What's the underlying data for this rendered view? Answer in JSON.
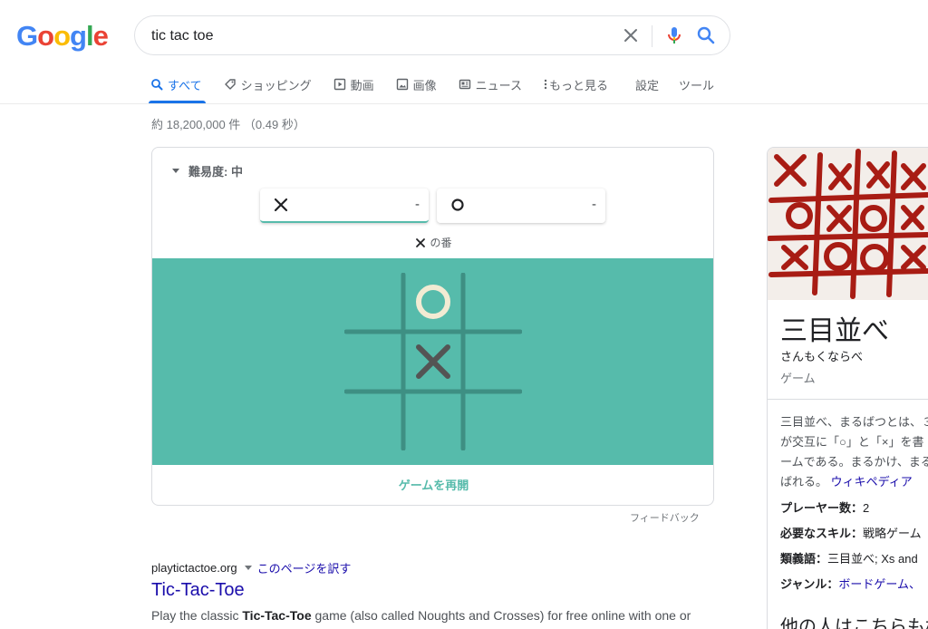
{
  "logo": {
    "letters": [
      "G",
      "o",
      "o",
      "g",
      "l",
      "e"
    ],
    "colors": [
      "#4285f4",
      "#ea4335",
      "#fbbc05",
      "#4285f4",
      "#34a853",
      "#ea4335"
    ]
  },
  "search": {
    "query": "tic tac toe"
  },
  "tabs": [
    {
      "label": "すべて",
      "icon": "search-icon",
      "active": true
    },
    {
      "label": "ショッピング",
      "icon": "tag-icon"
    },
    {
      "label": "動画",
      "icon": "video-icon"
    },
    {
      "label": "画像",
      "icon": "image-icon"
    },
    {
      "label": "ニュース",
      "icon": "news-icon"
    },
    {
      "label": "もっと見る",
      "icon": "more-vert-icon"
    }
  ],
  "tools": {
    "settings": "設定",
    "tools": "ツール"
  },
  "stats": "約 18,200,000 件 （0.49 秒）",
  "game": {
    "difficulty": "難易度: 中",
    "player1": {
      "mark": "X",
      "score": "-"
    },
    "player2": {
      "mark": "O",
      "score": "-"
    },
    "turn": "の番",
    "board": [
      "",
      "O",
      "",
      "",
      "X",
      "",
      "",
      "",
      ""
    ],
    "restart": "ゲームを再開",
    "board_color": "#56bbab"
  },
  "feedback": "フィードバック",
  "result": {
    "domain": "playtictactoe.org",
    "translate": "このページを訳す",
    "title": "Tic-Tac-Toe",
    "snippet_pre": "Play the classic ",
    "snippet_bold": "Tic-Tac-Toe",
    "snippet_post": " game (also called Noughts and Crosses) for free online with one or"
  },
  "knowledge": {
    "title": "三目並べ",
    "reading": "さんもくならべ",
    "type": "ゲーム",
    "desc": [
      "三目並べ、まるばつとは、３",
      "が交互に「○」と「×」を書",
      "ームである。まるかけ、まる"
    ],
    "desc_last": "ばれる。",
    "desc_link": "ウィキペディア",
    "facts": [
      {
        "key": "プレーヤー数：",
        "value": "2"
      },
      {
        "key": "必要なスキル：",
        "value": "戦略ゲーム"
      },
      {
        "key": "類義語：",
        "value": "三目並べ; Xs and"
      },
      {
        "key": "ジャンル：",
        "value": "ボードゲーム、",
        "link": true
      }
    ],
    "more": "他の人はこちらも検"
  }
}
